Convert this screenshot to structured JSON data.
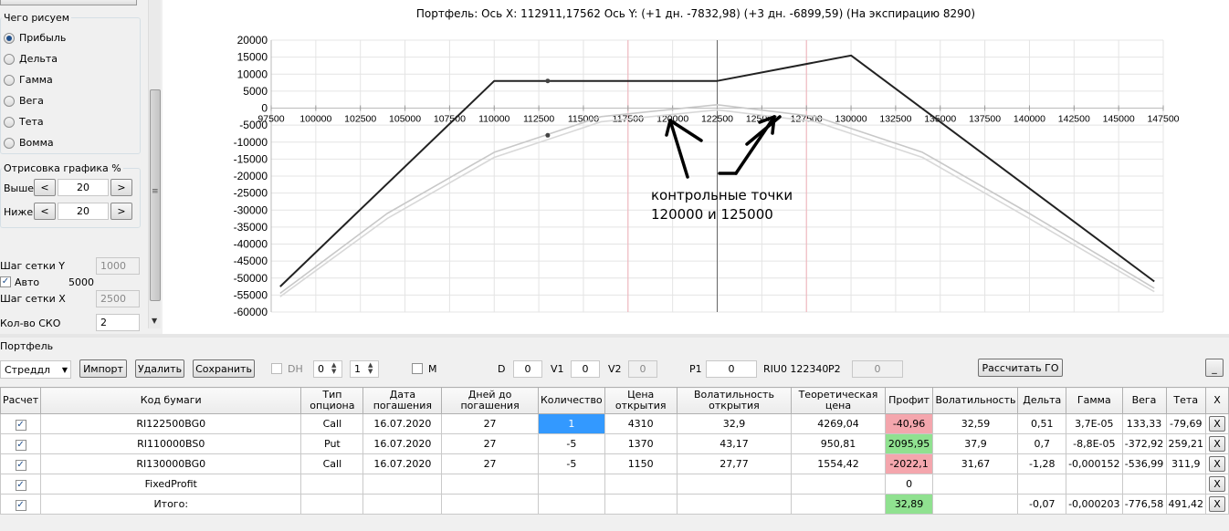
{
  "left_panel": {
    "group_draw_title": "Чего рисуем",
    "draw_options": [
      {
        "label": "Прибыль",
        "selected": true
      },
      {
        "label": "Дельта",
        "selected": false
      },
      {
        "label": "Гамма",
        "selected": false
      },
      {
        "label": "Вега",
        "selected": false
      },
      {
        "label": "Тета",
        "selected": false
      },
      {
        "label": "Вомма",
        "selected": false
      }
    ],
    "group_percent_title": "Отрисовка графика %",
    "above_label": "Выше",
    "above_value": "20",
    "below_label": "Ниже",
    "below_value": "20",
    "prev_symbol": "<",
    "next_symbol": ">",
    "grid_y_label": "Шаг сетки Y",
    "grid_y_value": "1000",
    "auto_label": "Авто",
    "auto_value": "5000",
    "grid_x_label": "Шаг сетки X",
    "grid_x_value": "2500",
    "sko_label": "Кол-во СКО",
    "sko_value": "2"
  },
  "chart_data": {
    "type": "line",
    "title": "Портфель: Ось X:  112911,17562 Ось Y:   (+1 дн. -7832,98)  (+3 дн. -6899,59)  (На экспирацию 8290)",
    "x_ticks": [
      "97500",
      "100000",
      "102500",
      "105000",
      "107500",
      "110000",
      "112500",
      "115000",
      "117500",
      "120000",
      "122500",
      "125000",
      "127500",
      "130000",
      "132500",
      "135000",
      "137500",
      "140000",
      "142500",
      "145000",
      "147500"
    ],
    "y_ticks": [
      "20000",
      "15000",
      "10000",
      "5000",
      "0",
      "-5000",
      "-10000",
      "-15000",
      "-20000",
      "-25000",
      "-30000",
      "-35000",
      "-40000",
      "-45000",
      "-50000",
      "-55000",
      "-60000"
    ],
    "xlim": [
      97500,
      147500
    ],
    "ylim": [
      -60000,
      20000
    ],
    "grid": true,
    "series": [
      {
        "color": "#222222",
        "x": [
          98000,
          110000,
          122500,
          130000,
          147000
        ],
        "y": [
          -52500,
          8000,
          8000,
          15500,
          -51000
        ]
      },
      {
        "color": "#c8c8c8",
        "x": [
          98000,
          104000,
          110000,
          116000,
          122500,
          128000,
          134000,
          140000,
          147000
        ],
        "y": [
          -54500,
          -31000,
          -13000,
          -2500,
          1000,
          -2500,
          -13000,
          -31000,
          -53000
        ]
      },
      {
        "color": "#d8d8d8",
        "x": [
          98000,
          104000,
          110000,
          116000,
          122500,
          128000,
          134000,
          140000,
          147000
        ],
        "y": [
          -55500,
          -32500,
          -14500,
          -4000,
          -500,
          -4000,
          -14500,
          -32500,
          -54000
        ]
      }
    ],
    "markers": [
      {
        "x": 113000,
        "y": 8000
      },
      {
        "x": 113000,
        "y": -8000
      }
    ],
    "vlines": [
      {
        "x": 117500,
        "color": "#f0b0b8"
      },
      {
        "x": 122500,
        "color": "#666666"
      },
      {
        "x": 127500,
        "color": "#f0b0b8"
      }
    ]
  },
  "annotation": {
    "line1": "контрольные точки",
    "line2": "120000 и 125000"
  },
  "portfolio": {
    "panel_title": "Портфель",
    "strategy": "Стреддл",
    "import_label": "Импорт",
    "delete_label": "Удалить",
    "save_label": "Сохранить",
    "dh_label": "DH",
    "spin1": "0",
    "spin2": "1",
    "m_label": "M",
    "d_label": "D",
    "d_value": "0",
    "v1_label": "V1",
    "v1_value": "0",
    "v2_label": "V2",
    "v2_value": "0",
    "p1_label": "P1",
    "p1_value": "0",
    "riu_text": "RIU0 122340",
    "p2_label": "P2",
    "p2_value": "0",
    "calc_label": "Рассчитать ГО",
    "minimize_label": "_"
  },
  "table": {
    "headers": [
      "Расчет",
      "Код бумаги",
      "Тип опциона",
      "Дата погашения",
      "Дней до погашения",
      "Количество",
      "Цена открытия",
      "Волатильность открытия",
      "Теоретическая цена",
      "Профит",
      "Волатильность",
      "Дельта",
      "Гамма",
      "Вега",
      "Тета",
      "X"
    ],
    "rows": [
      [
        "✓",
        "RI122500BG0",
        "Call",
        "16.07.2020",
        "27",
        "1",
        "4310",
        "32,9",
        "4269,04",
        "-40,96",
        "32,59",
        "0,51",
        "3,7E-05",
        "133,33",
        "-79,69",
        "X"
      ],
      [
        "✓",
        "RI110000BS0",
        "Put",
        "16.07.2020",
        "27",
        "-5",
        "1370",
        "43,17",
        "950,81",
        "2095,95",
        "37,9",
        "0,7",
        "-8,8E-05",
        "-372,92",
        "259,21",
        "X"
      ],
      [
        "✓",
        "RI130000BG0",
        "Call",
        "16.07.2020",
        "27",
        "-5",
        "1150",
        "27,77",
        "1554,42",
        "-2022,1",
        "31,67",
        "-1,28",
        "-0,000152",
        "-536,99",
        "311,9",
        "X"
      ],
      [
        "✓",
        "FixedProfit",
        "",
        "",
        "",
        "",
        "",
        "",
        "",
        "0",
        "",
        "",
        "",
        "",
        "",
        "X"
      ],
      [
        "✓",
        "Итого:",
        "",
        "",
        "",
        "",
        "",
        "",
        "",
        "32,89",
        "",
        "-0,07",
        "-0,000203",
        "-776,58",
        "491,42",
        "X"
      ]
    ],
    "cell_styles": [
      [
        "",
        "",
        "",
        "",
        "",
        "sel",
        "",
        "",
        "",
        "red",
        "",
        "",
        "",
        "",
        "",
        ""
      ],
      [
        "",
        "",
        "",
        "",
        "",
        "",
        "",
        "",
        "",
        "green",
        "",
        "",
        "",
        "",
        "",
        ""
      ],
      [
        "",
        "",
        "",
        "",
        "",
        "",
        "",
        "",
        "",
        "red",
        "",
        "",
        "",
        "",
        "",
        ""
      ],
      [
        "",
        "",
        "",
        "",
        "",
        "",
        "",
        "",
        "",
        "",
        "",
        "",
        "",
        "",
        "",
        ""
      ],
      [
        "",
        "",
        "",
        "",
        "",
        "",
        "",
        "",
        "",
        "green",
        "",
        "",
        "",
        "",
        "",
        ""
      ]
    ]
  }
}
